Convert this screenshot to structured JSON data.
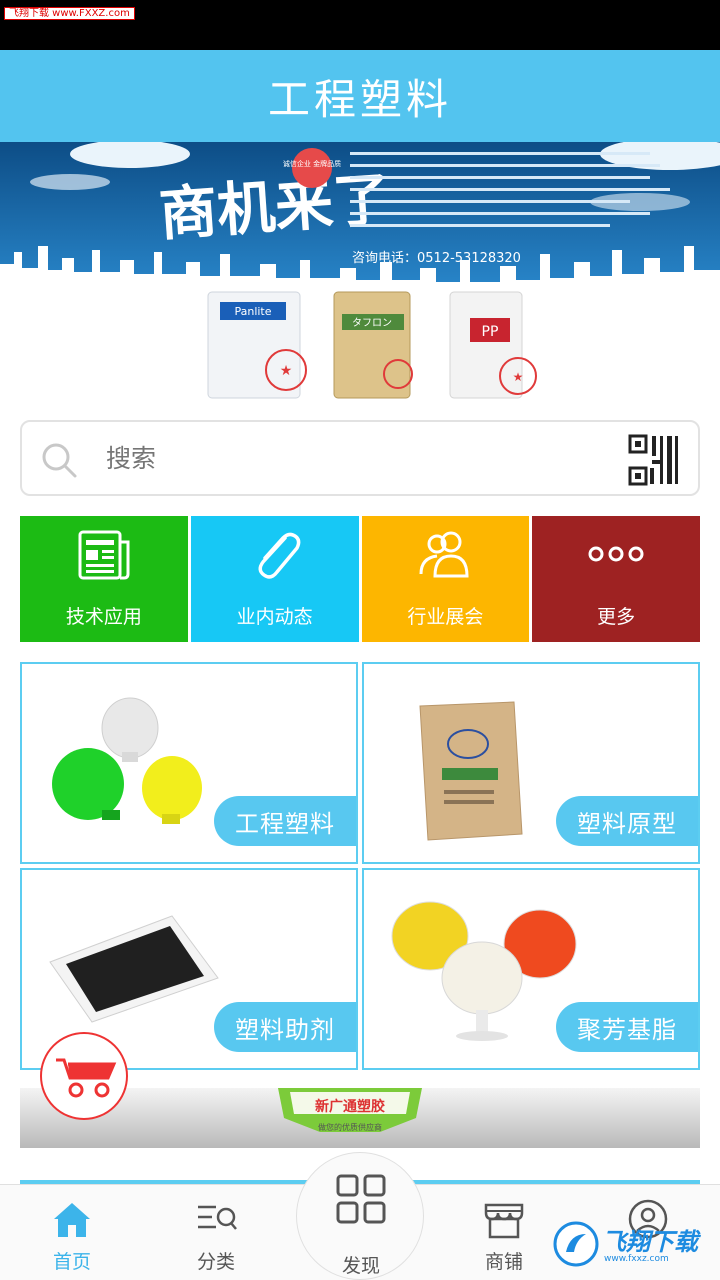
{
  "status_bar": {
    "watermark": "飞翔下载 www.FXXZ.com"
  },
  "header": {
    "title": "工程塑料"
  },
  "banner": {
    "headline": "商机来了",
    "stamp": "诚信企业 金牌品质",
    "phone": "咨询电话：0512-53128320",
    "products": [
      "Panlite",
      "タフロン",
      "PP"
    ]
  },
  "search": {
    "placeholder": "搜索"
  },
  "categories": [
    {
      "label": "技术应用",
      "icon": "newspaper-icon",
      "color": "#1cbb14"
    },
    {
      "label": "业内动态",
      "icon": "paperclip-icon",
      "color": "#17c8f5"
    },
    {
      "label": "行业展会",
      "icon": "people-icon",
      "color": "#fdb600"
    },
    {
      "label": "更多",
      "icon": "more-dots-icon",
      "color": "#9e2222"
    }
  ],
  "products": [
    {
      "label": "工程塑料"
    },
    {
      "label": "塑料原型"
    },
    {
      "label": "塑料助剂"
    },
    {
      "label": "聚芳基脂"
    }
  ],
  "ad": {
    "name": "新广通塑胶",
    "slogan": "做您的优质供应商"
  },
  "tabbar": {
    "home": "首页",
    "category": "分类",
    "discover": "发现",
    "shop": "商铺",
    "profile": ""
  },
  "watermark_bottom": {
    "text": "飞翔下载",
    "url": "www.fxxz.com"
  },
  "colors": {
    "accent": "#53c4ef",
    "green": "#1cbb14",
    "cyan": "#17c8f5",
    "orange": "#fdb600",
    "maroon": "#9e2222"
  }
}
